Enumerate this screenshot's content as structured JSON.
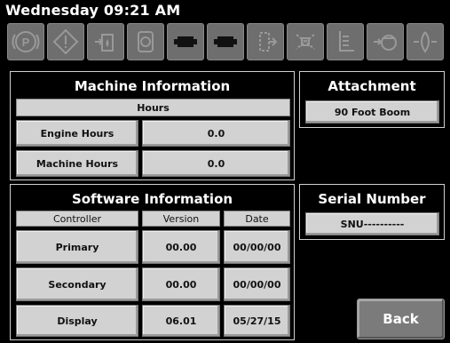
{
  "header": {
    "datetime": "Wednesday 09:21 AM"
  },
  "icons": [
    "parking-brake-icon",
    "warning-icon",
    "fuel-filter-icon",
    "hydraulic-filter-icon",
    "engine-icon",
    "engine-2-icon",
    "hydraulic-pump-icon",
    "spray-nozzle-icon",
    "transmission-oil-icon",
    "hydraulic-oil-icon",
    "coolant-icon"
  ],
  "machine_info": {
    "title": "Machine Information",
    "hours_header": "Hours",
    "rows": [
      {
        "label": "Engine Hours",
        "value": "0.0"
      },
      {
        "label": "Machine Hours",
        "value": "0.0"
      }
    ]
  },
  "attachment": {
    "title": "Attachment",
    "value": "90 Foot Boom"
  },
  "software_info": {
    "title": "Software Information",
    "headers": [
      "Controller",
      "Version",
      "Date"
    ],
    "rows": [
      {
        "controller": "Primary",
        "version": "00.00",
        "date": "00/00/00"
      },
      {
        "controller": "Secondary",
        "version": "00.00",
        "date": "00/00/00"
      },
      {
        "controller": "Display",
        "version": "06.01",
        "date": "05/27/15"
      }
    ]
  },
  "serial": {
    "title": "Serial Number",
    "value": "SNU----------"
  },
  "back_label": "Back"
}
